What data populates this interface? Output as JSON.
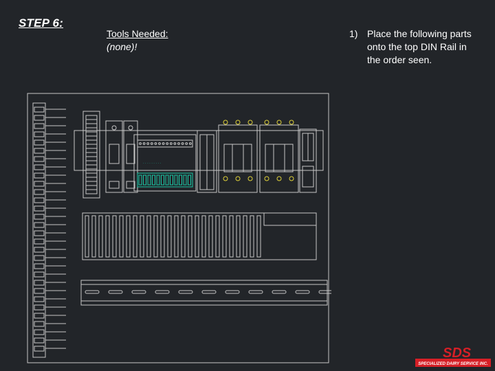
{
  "step": {
    "title": "STEP 6:"
  },
  "tools": {
    "label": "Tools Needed:",
    "value": "(none)!"
  },
  "instructions": [
    {
      "number": "1)",
      "text": "Place the following parts onto the top DIN Rail in the order seen."
    }
  ],
  "drawing": {
    "line_color": "#c8c8c8",
    "accent_green": "#19c9a6",
    "accent_yellow": "#e0d23a"
  },
  "logo": {
    "brand": "SDS",
    "tagline": "SPECIALIZED DAIRY SERVICE INC.",
    "color": "#d61f26"
  }
}
